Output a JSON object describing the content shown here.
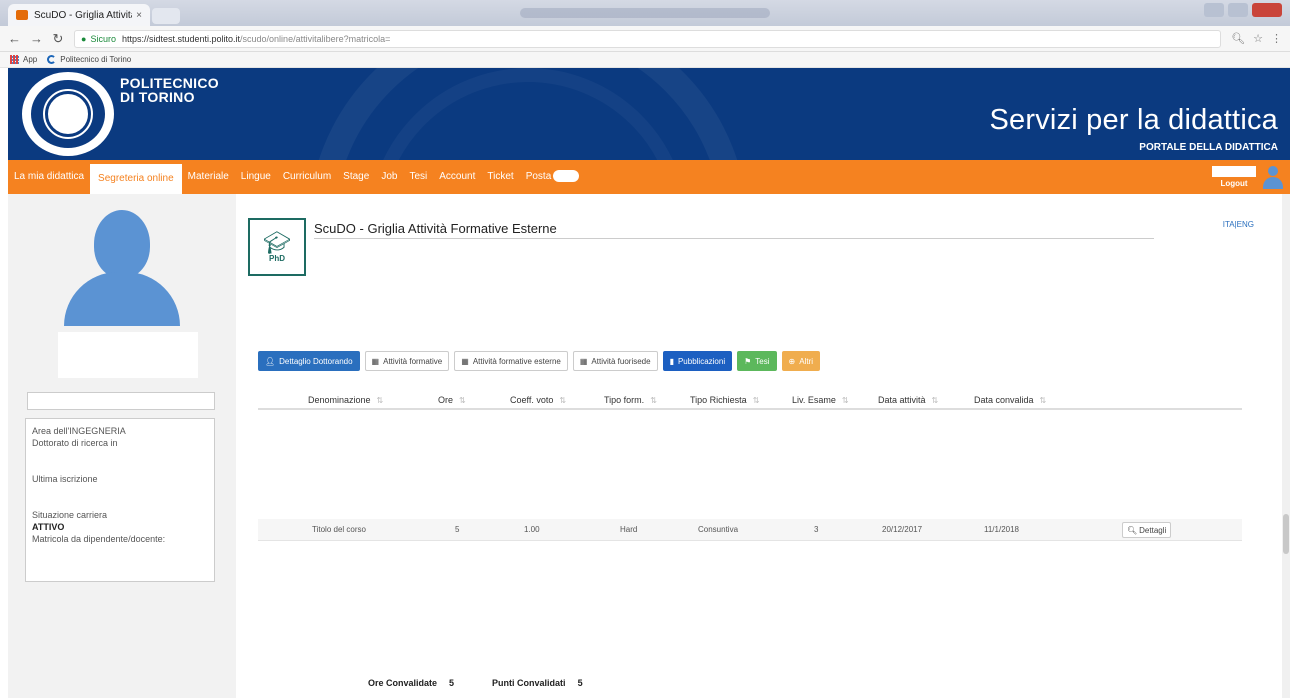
{
  "browser": {
    "tab_title": "ScuDO - Griglia Attività",
    "tab_close": "×",
    "secure_label": "Sicuro",
    "url_host": "https://sidtest.studenti.polito.it",
    "url_path": "/scudo/online/attivitalibere?matricola=",
    "bookmarks": [
      {
        "label": "App",
        "icon": "apps-icon"
      },
      {
        "label": "Politecnico di Torino",
        "icon": "polito-icon"
      }
    ]
  },
  "header": {
    "university_line1": "POLITECNICO",
    "university_line2": "DI TORINO",
    "title": "Servizi per la didattica",
    "subtitle": "PORTALE DELLA DIDATTICA",
    "brand_color": "#0b3a80"
  },
  "nav": {
    "items": [
      {
        "label": "La mia didattica"
      },
      {
        "label": "Segreteria online",
        "active": true
      },
      {
        "label": "Materiale"
      },
      {
        "label": "Lingue"
      },
      {
        "label": "Curriculum"
      },
      {
        "label": "Stage"
      },
      {
        "label": "Job"
      },
      {
        "label": "Tesi"
      },
      {
        "label": "Account"
      },
      {
        "label": "Ticket"
      },
      {
        "label": "Posta"
      }
    ],
    "logout": "Logout",
    "accent_color": "#f58220"
  },
  "sidebar": {
    "area": "Area dell'INGEGNERIA",
    "doctorate": "Dottorato di ricerca in",
    "last_enrollment": "Ultima iscrizione",
    "career_status_label": "Situazione carriera",
    "career_status_value": "ATTIVO",
    "employee_id_label": "Matricola da dipendente/docente:"
  },
  "main": {
    "page_title": "ScuDO - Griglia Attività Formative Esterne",
    "lang_switch": "ITA|ENG",
    "phd_badge": "PhD",
    "tabs": [
      {
        "label": "Dettaglio Dottorando",
        "icon": "user-icon",
        "style": "blue"
      },
      {
        "label": "Attività formative",
        "icon": "grid-icon",
        "style": "default"
      },
      {
        "label": "Attività formative esterne",
        "icon": "grid-icon",
        "style": "default"
      },
      {
        "label": "Attività fuorisede",
        "icon": "grid-icon",
        "style": "default"
      },
      {
        "label": "Pubblicazioni",
        "icon": "book-icon",
        "style": "darkblue"
      },
      {
        "label": "Tesi",
        "icon": "comment-icon",
        "style": "green"
      },
      {
        "label": "Altri",
        "icon": "plus-circle-icon",
        "style": "orange"
      }
    ],
    "table": {
      "columns": [
        "Denominazione",
        "Ore",
        "Coeff. voto",
        "Tipo form.",
        "Tipo Richiesta",
        "Liv. Esame",
        "Data attività",
        "Data convalida"
      ],
      "rows": [
        [
          "Titolo del corso",
          "5",
          "1.00",
          "Hard",
          "Consuntiva",
          "3",
          "20/12/2017",
          "11/1/2018"
        ]
      ],
      "details_label": "Dettagli"
    },
    "totals": {
      "ore_label": "Ore Convalidate",
      "ore_value": "5",
      "punti_label": "Punti Convalidati",
      "punti_value": "5"
    }
  }
}
